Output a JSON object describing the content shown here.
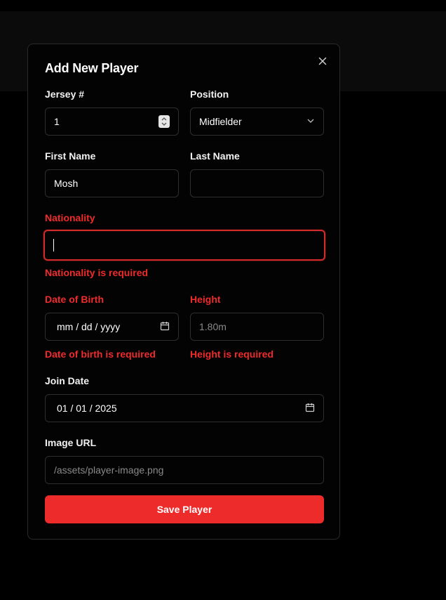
{
  "dialog": {
    "title": "Add New Player",
    "close_icon": "close-icon"
  },
  "form": {
    "jersey": {
      "label": "Jersey #",
      "value": "1",
      "icon": "number-stepper-icon"
    },
    "position": {
      "label": "Position",
      "value": "Midfielder",
      "icon": "chevron-down-icon"
    },
    "first_name": {
      "label": "First Name",
      "value": "Mosh"
    },
    "last_name": {
      "label": "Last Name",
      "value": ""
    },
    "nationality": {
      "label": "Nationality",
      "value": "",
      "error": "Nationality is required"
    },
    "date_of_birth": {
      "label": "Date of Birth",
      "value": "mm / dd / yyyy",
      "error": "Date of birth is required",
      "icon": "calendar-icon"
    },
    "height": {
      "label": "Height",
      "placeholder": "1.80m",
      "error": "Height is required"
    },
    "join_date": {
      "label": "Join Date",
      "value": "01 / 01 / 2025",
      "icon": "calendar-icon"
    },
    "image_url": {
      "label": "Image URL",
      "placeholder": "/assets/player-image.png"
    },
    "submit_label": "Save Player"
  },
  "colors": {
    "background": "#000000",
    "error": "#ef2b2b",
    "primary_button": "#ee2b2b",
    "input_border": "#2e2e2e"
  }
}
